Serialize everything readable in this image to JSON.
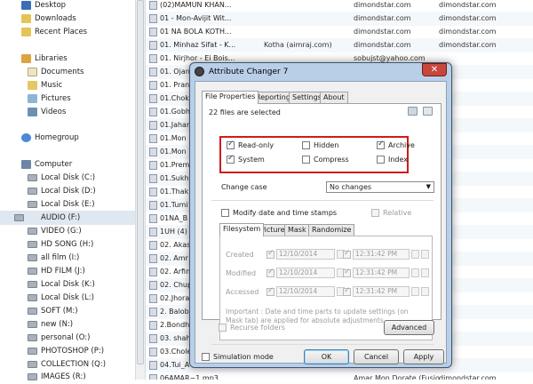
{
  "nav": {
    "items": [
      {
        "name": "nav-desktop",
        "label": "Desktop",
        "icon": "desktop-icon"
      },
      {
        "name": "nav-downloads",
        "label": "Downloads",
        "icon": "folder-icon"
      },
      {
        "name": "nav-recent-places",
        "label": "Recent Places",
        "icon": "folder-icon"
      },
      {
        "name": "nav-libraries",
        "label": "Libraries",
        "icon": "library-icon"
      },
      {
        "name": "nav-documents",
        "label": "Documents",
        "icon": "documents-icon"
      },
      {
        "name": "nav-music",
        "label": "Music",
        "icon": "music-icon"
      },
      {
        "name": "nav-pictures",
        "label": "Pictures",
        "icon": "pictures-icon"
      },
      {
        "name": "nav-videos",
        "label": "Videos",
        "icon": "videos-icon"
      },
      {
        "name": "nav-homegroup",
        "label": "Homegroup",
        "icon": "homegroup-icon"
      },
      {
        "name": "nav-computer",
        "label": "Computer",
        "icon": "computer-icon"
      },
      {
        "name": "nav-drive-c",
        "label": "Local Disk (C:)",
        "icon": "drive-icon"
      },
      {
        "name": "nav-drive-d",
        "label": "Local Disk (D:)",
        "icon": "drive-icon"
      },
      {
        "name": "nav-drive-e",
        "label": "Local Disk (E:)",
        "icon": "drive-icon"
      },
      {
        "name": "nav-drive-f",
        "label": "AUDIO (F:)",
        "icon": "drive-icon",
        "selected": true
      },
      {
        "name": "nav-drive-g",
        "label": "VIDEO (G:)",
        "icon": "drive-icon"
      },
      {
        "name": "nav-drive-h",
        "label": "HD SONG (H:)",
        "icon": "drive-icon"
      },
      {
        "name": "nav-drive-i",
        "label": "all film (I:)",
        "icon": "drive-icon"
      },
      {
        "name": "nav-drive-j",
        "label": "HD FILM (J:)",
        "icon": "drive-icon"
      },
      {
        "name": "nav-drive-k",
        "label": "Local Disk (K:)",
        "icon": "drive-icon"
      },
      {
        "name": "nav-drive-l",
        "label": "Local Disk (L:)",
        "icon": "drive-icon"
      },
      {
        "name": "nav-drive-m",
        "label": "SOFT (M:)",
        "icon": "drive-icon"
      },
      {
        "name": "nav-drive-n",
        "label": "new (N:)",
        "icon": "drive-icon"
      },
      {
        "name": "nav-drive-o",
        "label": "personal (O:)",
        "icon": "drive-icon"
      },
      {
        "name": "nav-drive-p",
        "label": "PHOTOSHOP (P:)",
        "icon": "drive-icon"
      },
      {
        "name": "nav-drive-q",
        "label": "COLLECTION (Q:)",
        "icon": "drive-icon"
      },
      {
        "name": "nav-drive-r",
        "label": "IMAGES (R:)",
        "icon": "drive-icon"
      }
    ]
  },
  "files": [
    {
      "name": "(02)MAMUN KHAN...",
      "c2": "",
      "c3": "dimondstar.com",
      "c4": "dimondstar.com"
    },
    {
      "name": "01 - Mon-Avijit Wit...",
      "c2": "",
      "c3": "dimondstar.com",
      "c4": "dimondstar.com"
    },
    {
      "name": "01 NA BOLA KOTH...",
      "c2": "",
      "c3": "dimondstar.com",
      "c4": "dimondstar.com"
    },
    {
      "name": "01. Minhaz Sifat - K...",
      "c2": "Kotha (aimraj.com)",
      "c3": "dimondstar.com",
      "c4": "dimondstar.com"
    },
    {
      "name": "01. Nirjhor - Ei Bois...",
      "c2": "",
      "c3": "sobujst@yahoo.com",
      "c4": ""
    },
    {
      "name": "01. Ojan",
      "c2": "",
      "c3": "",
      "c4": ""
    },
    {
      "name": "01. Pran",
      "c2": "",
      "c3": "",
      "c4": ""
    },
    {
      "name": "01.Chok",
      "c2": "",
      "c3": "",
      "c4": ""
    },
    {
      "name": "01.Gobh",
      "c2": "",
      "c3": "",
      "c4": ""
    },
    {
      "name": "01.Jahar",
      "c2": "",
      "c3": "",
      "c4": ""
    },
    {
      "name": "01.Mon",
      "c2": "",
      "c3": "",
      "c4": ""
    },
    {
      "name": "01.Mon",
      "c2": "",
      "c3": "",
      "c4": ""
    },
    {
      "name": "01.Prem",
      "c2": "",
      "c3": "",
      "c4": ""
    },
    {
      "name": "01.Sukh",
      "c2": "",
      "c3": "",
      "c4": ""
    },
    {
      "name": "01.Thakl",
      "c2": "",
      "c3": "",
      "c4": ""
    },
    {
      "name": "01.Tumi",
      "c2": "",
      "c3": "",
      "c4": ""
    },
    {
      "name": "01NA_B",
      "c2": "",
      "c3": "",
      "c4": ""
    },
    {
      "name": "1UH (4)",
      "c2": "",
      "c3": "",
      "c4": ""
    },
    {
      "name": "02. Akas",
      "c2": "",
      "c3": "",
      "c4": ""
    },
    {
      "name": "02. Amr",
      "c2": "",
      "c3": "",
      "c4": ""
    },
    {
      "name": "02. Arfin",
      "c2": "",
      "c3": "",
      "c4": ""
    },
    {
      "name": "02. Chup",
      "c2": "",
      "c3": "",
      "c4": ""
    },
    {
      "name": "02.Jhora",
      "c2": "",
      "c3": "",
      "c4": ""
    },
    {
      "name": "2. Balob",
      "c2": "",
      "c3": "",
      "c4": ""
    },
    {
      "name": "2.Bondh",
      "c2": "",
      "c3": "",
      "c4": ""
    },
    {
      "name": "03. shah",
      "c2": "",
      "c3": "",
      "c4": ""
    },
    {
      "name": "03.Chole",
      "c2": "",
      "c3": "",
      "c4": ""
    },
    {
      "name": "04.Tui_A",
      "c2": "",
      "c3": "",
      "c4": ""
    },
    {
      "name": "06AMAR~1.mp3",
      "c2": "",
      "c3": "Amar Mon Dorate (Fusio...",
      "c4": "dimondstar.com"
    }
  ],
  "dialog": {
    "title": "Attribute Changer 7",
    "close_glyph": "✕",
    "tabs": [
      "File Properties",
      "Reporting",
      "Settings",
      "About"
    ],
    "files_selected": "22 files are selected",
    "attributes": [
      {
        "name": "readonly",
        "label": "Read-only",
        "checked": true
      },
      {
        "name": "hidden",
        "label": "Hidden",
        "checked": false
      },
      {
        "name": "archive",
        "label": "Archive",
        "checked": true
      },
      {
        "name": "system",
        "label": "System",
        "checked": true
      },
      {
        "name": "compress",
        "label": "Compress",
        "checked": false
      },
      {
        "name": "index",
        "label": "Index",
        "checked": false
      }
    ],
    "change_case_label": "Change case",
    "change_case_value": "No changes",
    "modify_dates_label": "Modify date and time stamps",
    "relative_label": "Relative",
    "subtabs": [
      "Filesystem",
      "Picture",
      "Mask",
      "Randomize"
    ],
    "date_rows": [
      {
        "name": "created",
        "label": "Created",
        "date": "12/10/2014",
        "time": "12:31:42 PM"
      },
      {
        "name": "modified",
        "label": "Modified",
        "date": "12/10/2014",
        "time": "12:31:42 PM"
      },
      {
        "name": "accessed",
        "label": "Accessed",
        "date": "12/10/2014",
        "time": "12:31:42 PM"
      }
    ],
    "note": "Important : Date and time parts to update settings (on Mask tab) are applied for absolute adjustments",
    "recurse_label": "Recurse folders",
    "advanced_label": "Advanced",
    "simulation_label": "Simulation mode",
    "ok_label": "OK",
    "cancel_label": "Cancel",
    "apply_label": "Apply"
  },
  "colors": {
    "highlight_box": "#d01b1b",
    "selected_nav": "#dfe7f1"
  }
}
